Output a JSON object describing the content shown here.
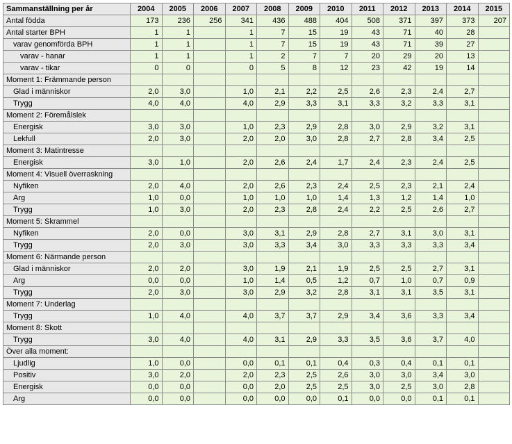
{
  "header": {
    "title": "Sammanställning per år",
    "years": [
      "2004",
      "2005",
      "2006",
      "2007",
      "2008",
      "2009",
      "2010",
      "2011",
      "2012",
      "2013",
      "2014",
      "2015"
    ]
  },
  "rows": [
    {
      "kind": "head",
      "label": "Antal födda",
      "vals": [
        "173",
        "236",
        "256",
        "341",
        "436",
        "488",
        "404",
        "508",
        "371",
        "397",
        "373",
        "207"
      ]
    },
    {
      "kind": "head",
      "label": "Antal starter BPH",
      "vals": [
        "1",
        "1",
        "",
        "1",
        "7",
        "15",
        "19",
        "43",
        "71",
        "40",
        "28",
        ""
      ]
    },
    {
      "kind": "sub",
      "label": "varav genomförda BPH",
      "vals": [
        "1",
        "1",
        "",
        "1",
        "7",
        "15",
        "19",
        "43",
        "71",
        "39",
        "27",
        ""
      ]
    },
    {
      "kind": "sub2",
      "label": "varav - hanar",
      "vals": [
        "1",
        "1",
        "",
        "1",
        "2",
        "7",
        "7",
        "20",
        "29",
        "20",
        "13",
        ""
      ]
    },
    {
      "kind": "sub2",
      "label": "varav - tikar",
      "vals": [
        "0",
        "0",
        "",
        "0",
        "5",
        "8",
        "12",
        "23",
        "42",
        "19",
        "14",
        ""
      ]
    },
    {
      "kind": "head",
      "label": "Moment 1: Främmande person",
      "vals": [
        "",
        "",
        "",
        "",
        "",
        "",
        "",
        "",
        "",
        "",
        "",
        ""
      ]
    },
    {
      "kind": "sub",
      "label": "Glad i människor",
      "vals": [
        "2,0",
        "3,0",
        "",
        "1,0",
        "2,1",
        "2,2",
        "2,5",
        "2,6",
        "2,3",
        "2,4",
        "2,7",
        ""
      ]
    },
    {
      "kind": "sub",
      "label": "Trygg",
      "vals": [
        "4,0",
        "4,0",
        "",
        "4,0",
        "2,9",
        "3,3",
        "3,1",
        "3,3",
        "3,2",
        "3,3",
        "3,1",
        ""
      ]
    },
    {
      "kind": "head",
      "label": "Moment 2: Föremålslek",
      "vals": [
        "",
        "",
        "",
        "",
        "",
        "",
        "",
        "",
        "",
        "",
        "",
        ""
      ]
    },
    {
      "kind": "sub",
      "label": "Energisk",
      "vals": [
        "3,0",
        "3,0",
        "",
        "1,0",
        "2,3",
        "2,9",
        "2,8",
        "3,0",
        "2,9",
        "3,2",
        "3,1",
        ""
      ]
    },
    {
      "kind": "sub",
      "label": "Lekfull",
      "vals": [
        "2,0",
        "3,0",
        "",
        "2,0",
        "2,0",
        "3,0",
        "2,8",
        "2,7",
        "2,8",
        "3,4",
        "2,5",
        ""
      ]
    },
    {
      "kind": "head",
      "label": "Moment 3: Matintresse",
      "vals": [
        "",
        "",
        "",
        "",
        "",
        "",
        "",
        "",
        "",
        "",
        "",
        ""
      ]
    },
    {
      "kind": "sub",
      "label": "Energisk",
      "vals": [
        "3,0",
        "1,0",
        "",
        "2,0",
        "2,6",
        "2,4",
        "1,7",
        "2,4",
        "2,3",
        "2,4",
        "2,5",
        ""
      ]
    },
    {
      "kind": "head",
      "label": "Moment 4: Visuell överraskning",
      "vals": [
        "",
        "",
        "",
        "",
        "",
        "",
        "",
        "",
        "",
        "",
        "",
        ""
      ]
    },
    {
      "kind": "sub",
      "label": "Nyfiken",
      "vals": [
        "2,0",
        "4,0",
        "",
        "2,0",
        "2,6",
        "2,3",
        "2,4",
        "2,5",
        "2,3",
        "2,1",
        "2,4",
        ""
      ]
    },
    {
      "kind": "sub",
      "label": "Arg",
      "vals": [
        "1,0",
        "0,0",
        "",
        "1,0",
        "1,0",
        "1,0",
        "1,4",
        "1,3",
        "1,2",
        "1,4",
        "1,0",
        ""
      ]
    },
    {
      "kind": "sub",
      "label": "Trygg",
      "vals": [
        "1,0",
        "3,0",
        "",
        "2,0",
        "2,3",
        "2,8",
        "2,4",
        "2,2",
        "2,5",
        "2,6",
        "2,7",
        ""
      ]
    },
    {
      "kind": "head",
      "label": "Moment 5: Skrammel",
      "vals": [
        "",
        "",
        "",
        "",
        "",
        "",
        "",
        "",
        "",
        "",
        "",
        ""
      ]
    },
    {
      "kind": "sub",
      "label": "Nyfiken",
      "vals": [
        "2,0",
        "0,0",
        "",
        "3,0",
        "3,1",
        "2,9",
        "2,8",
        "2,7",
        "3,1",
        "3,0",
        "3,1",
        ""
      ]
    },
    {
      "kind": "sub",
      "label": "Trygg",
      "vals": [
        "2,0",
        "3,0",
        "",
        "3,0",
        "3,3",
        "3,4",
        "3,0",
        "3,3",
        "3,3",
        "3,3",
        "3,4",
        ""
      ]
    },
    {
      "kind": "head",
      "label": "Moment 6: Närmande person",
      "vals": [
        "",
        "",
        "",
        "",
        "",
        "",
        "",
        "",
        "",
        "",
        "",
        ""
      ]
    },
    {
      "kind": "sub",
      "label": "Glad i människor",
      "vals": [
        "2,0",
        "2,0",
        "",
        "3,0",
        "1,9",
        "2,1",
        "1,9",
        "2,5",
        "2,5",
        "2,7",
        "3,1",
        ""
      ]
    },
    {
      "kind": "sub",
      "label": "Arg",
      "vals": [
        "0,0",
        "0,0",
        "",
        "1,0",
        "1,4",
        "0,5",
        "1,2",
        "0,7",
        "1,0",
        "0,7",
        "0,9",
        ""
      ]
    },
    {
      "kind": "sub",
      "label": "Trygg",
      "vals": [
        "2,0",
        "3,0",
        "",
        "3,0",
        "2,9",
        "3,2",
        "2,8",
        "3,1",
        "3,1",
        "3,5",
        "3,1",
        ""
      ]
    },
    {
      "kind": "head",
      "label": "Moment 7: Underlag",
      "vals": [
        "",
        "",
        "",
        "",
        "",
        "",
        "",
        "",
        "",
        "",
        "",
        ""
      ]
    },
    {
      "kind": "sub",
      "label": "Trygg",
      "vals": [
        "1,0",
        "4,0",
        "",
        "4,0",
        "3,7",
        "3,7",
        "2,9",
        "3,4",
        "3,6",
        "3,3",
        "3,4",
        ""
      ]
    },
    {
      "kind": "head",
      "label": "Moment 8: Skott",
      "vals": [
        "",
        "",
        "",
        "",
        "",
        "",
        "",
        "",
        "",
        "",
        "",
        ""
      ]
    },
    {
      "kind": "sub",
      "label": "Trygg",
      "vals": [
        "3,0",
        "4,0",
        "",
        "4,0",
        "3,1",
        "2,9",
        "3,3",
        "3,5",
        "3,6",
        "3,7",
        "4,0",
        ""
      ]
    },
    {
      "kind": "head",
      "label": "Över alla moment:",
      "vals": [
        "",
        "",
        "",
        "",
        "",
        "",
        "",
        "",
        "",
        "",
        "",
        ""
      ]
    },
    {
      "kind": "sub",
      "label": "Ljudlig",
      "vals": [
        "1,0",
        "0,0",
        "",
        "0,0",
        "0,1",
        "0,1",
        "0,4",
        "0,3",
        "0,4",
        "0,1",
        "0,1",
        ""
      ]
    },
    {
      "kind": "sub",
      "label": "Positiv",
      "vals": [
        "3,0",
        "2,0",
        "",
        "2,0",
        "2,3",
        "2,5",
        "2,6",
        "3,0",
        "3,0",
        "3,4",
        "3,0",
        ""
      ]
    },
    {
      "kind": "sub",
      "label": "Energisk",
      "vals": [
        "0,0",
        "0,0",
        "",
        "0,0",
        "2,0",
        "2,5",
        "2,5",
        "3,0",
        "2,5",
        "3,0",
        "2,8",
        ""
      ]
    },
    {
      "kind": "sub",
      "label": "Arg",
      "vals": [
        "0,0",
        "0,0",
        "",
        "0,0",
        "0,0",
        "0,0",
        "0,1",
        "0,0",
        "0,0",
        "0,1",
        "0,1",
        ""
      ]
    }
  ]
}
